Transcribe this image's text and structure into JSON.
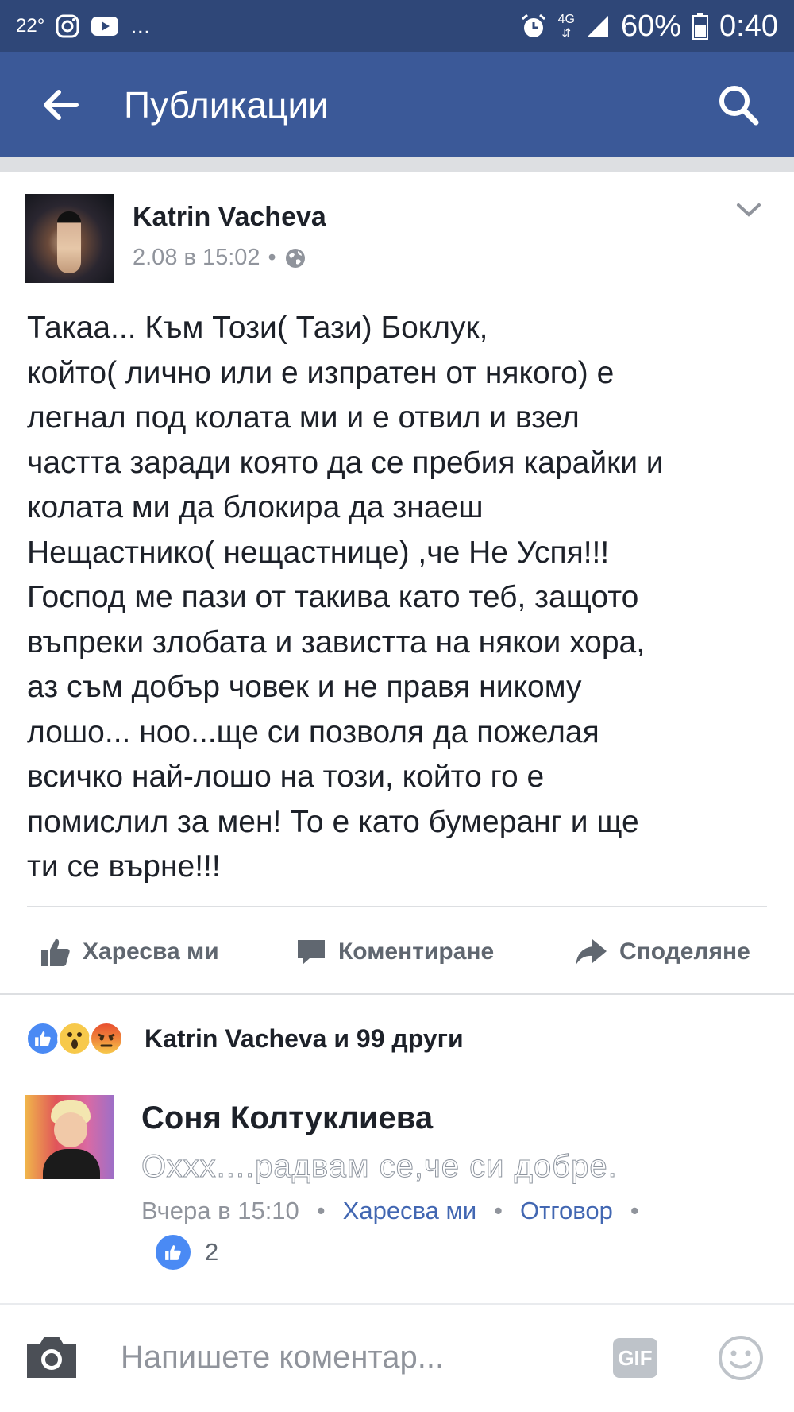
{
  "status_bar": {
    "temperature": "22°",
    "more": "...",
    "network": "4G",
    "battery": "60%",
    "time": "0:40"
  },
  "header": {
    "title": "Публикации"
  },
  "post": {
    "author": "Katrin Vacheva",
    "timestamp": "2.08 в 15:02",
    "meta_separator": "•",
    "body_lines": [
      "Такаа... Към Този( Тази) Боклук,",
      "който( лично или е изпратен от някого) е",
      "легнал под колата ми и е отвил и взел",
      "частта заради която да се пребия карайки и",
      "колата ми да блокира да знаеш",
      "Нещастнико( нещастнице) ,че Не Успя!!!",
      "Господ ме пази от такива като теб, защото",
      "въпреки злобата и завистта на някои хора,",
      "аз съм добър човек и не правя никому",
      "лошо... ноо...ще си позволя да пожелая",
      "всичко най-лошо на този, който го е",
      "помислил за мен! То е като бумеранг и ще",
      "ти се върне!!!"
    ]
  },
  "actions": {
    "like": "Харесва ми",
    "comment": "Коментиране",
    "share": "Споделяне"
  },
  "reactions": {
    "summary": "Katrin Vacheva и 99 други",
    "types": [
      "like",
      "wow",
      "angry"
    ]
  },
  "comment": {
    "author": "Соня Колтуклиева",
    "text": "Оххх....радвам се,че си добре.",
    "time": "Вчера в 15:10",
    "separator": "•",
    "like_link": "Харесва ми",
    "reply_link": "Отговор",
    "like_count": "2"
  },
  "composer": {
    "placeholder": "Напишете коментар...",
    "gif_label": "GIF"
  },
  "colors": {
    "status_bar": "#2f4778",
    "app_bar": "#3b5998",
    "link": "#4267b2",
    "like_blue": "#4a8af4",
    "muted": "#90949c"
  }
}
